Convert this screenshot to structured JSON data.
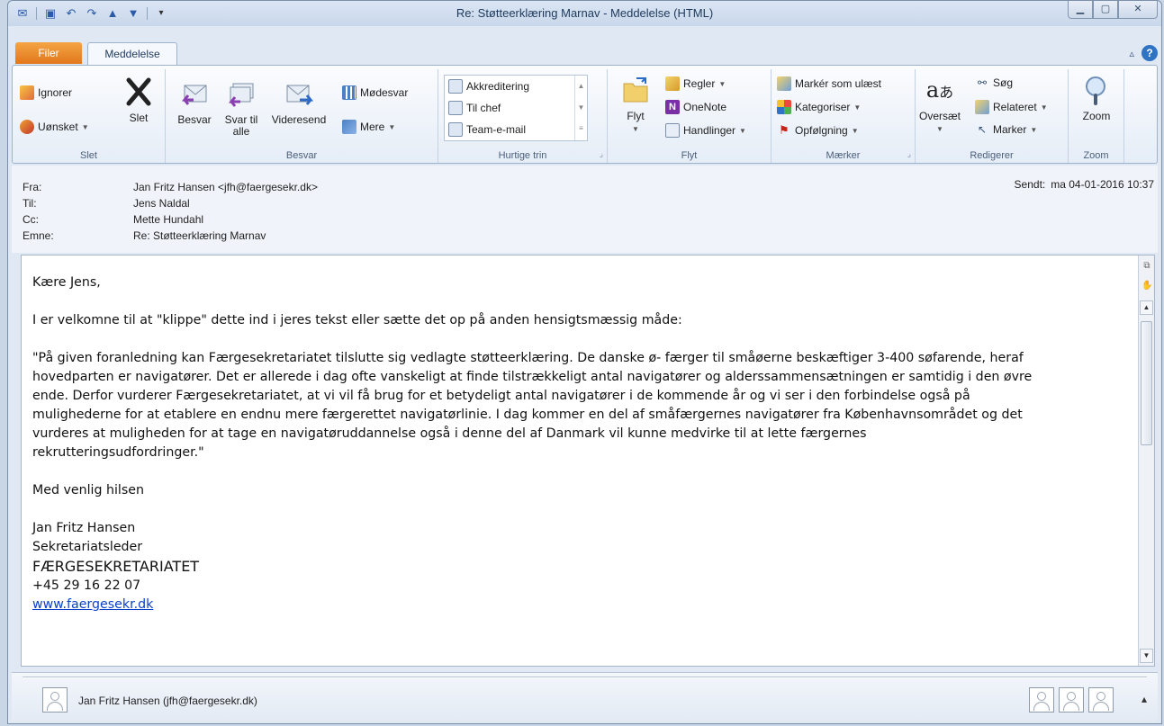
{
  "window": {
    "title": "Re: Støtteerklæring Marnav - Meddelelse (HTML)"
  },
  "tabs": {
    "file": "Filer",
    "message": "Meddelelse"
  },
  "ribbon": {
    "slet": {
      "label": "Slet",
      "ignore": "Ignorer",
      "junk": "Uønsket",
      "delete": "Slet"
    },
    "besvar": {
      "label": "Besvar",
      "reply": "Besvar",
      "reply_all": "Svar til alle",
      "forward": "Videresend",
      "meeting": "Mødesvar",
      "more": "Mere"
    },
    "quicksteps": {
      "label": "Hurtige trin",
      "items": [
        "Akkreditering",
        "Til chef",
        "Team-e-mail"
      ]
    },
    "flyt": {
      "label": "Flyt",
      "move": "Flyt",
      "rules": "Regler",
      "onenote": "OneNote",
      "actions": "Handlinger"
    },
    "maerker": {
      "label": "Mærker",
      "mark_unread": "Markér som ulæst",
      "categorize": "Kategoriser",
      "followup": "Opfølgning"
    },
    "redigerer": {
      "label": "Redigerer",
      "translate": "Oversæt",
      "find": "Søg",
      "related": "Relateret",
      "select": "Marker"
    },
    "zoom": {
      "label": "Zoom",
      "zoom": "Zoom"
    }
  },
  "header": {
    "from_label": "Fra:",
    "from": "Jan Fritz Hansen <jfh@faergesekr.dk>",
    "to_label": "Til:",
    "to": "Jens Naldal",
    "cc_label": "Cc:",
    "cc": "Mette Hundahl",
    "subject_label": "Emne:",
    "subject": "Re: Støtteerklæring Marnav",
    "sent_label": "Sendt:",
    "sent": "ma 04-01-2016 10:37"
  },
  "body": {
    "greeting": "Kære Jens,",
    "intro": "I er velkomne til at \"klippe\" dette ind i jeres tekst eller sætte det op på anden hensigtsmæssig måde:",
    "quote_lines": [
      "\"På given foranledning kan Færgesekretariatet tilslutte sig vedlagte støtteerklæring. De danske ø- færger til småøerne beskæftiger 3-400 søfarende, heraf",
      "hovedparten er navigatører. Det er allerede i dag ofte vanskeligt at finde tilstrækkeligt antal navigatører og alderssammensætningen er samtidig i den øvre",
      "ende. Derfor vurderer Færgesekretariatet, at vi vil få brug for et betydeligt antal navigatører i de kommende år og vi ser i den forbindelse også på",
      "mulighederne for at etablere en endnu mere færgerettet navigatørlinie. I dag kommer en del af småfærgernes navigatører fra Københavnsområdet og det",
      "vurderes at muligheden for at tage en navigatøruddannelse også i denne del af Danmark vil kunne medvirke til at lette færgernes",
      "rekrutteringsudfordringer.\""
    ],
    "closing": "Med venlig hilsen",
    "sig_name": "Jan Fritz Hansen",
    "sig_title": "Sekretariatsleder",
    "sig_org": "FÆRGESEKRETARIATET",
    "sig_phone": "+45 29 16 22 07",
    "sig_web": "www.faergesekr.dk"
  },
  "people_pane": {
    "name": "Jan Fritz Hansen (jfh@faergesekr.dk)"
  },
  "colors": {
    "file_tab": "#e0781b",
    "link": "#0b41c8",
    "ribbon_bg": "#e5edf7"
  }
}
